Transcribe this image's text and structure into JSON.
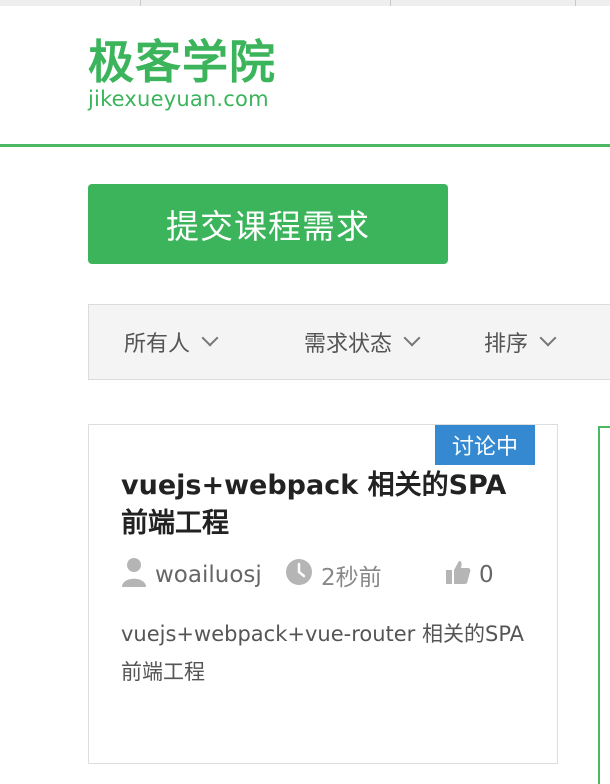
{
  "header": {
    "logo_cn": "极客学院",
    "logo_en": "jikexueyuan.com"
  },
  "actions": {
    "submit_label": "提交课程需求"
  },
  "filters": [
    {
      "label": "所有人"
    },
    {
      "label": "需求状态"
    },
    {
      "label": "排序"
    }
  ],
  "card": {
    "status": "讨论中",
    "title": "vuejs+webpack 相关的SPA前端工程",
    "author": "woailuosj",
    "time": "2秒前",
    "likes": "0",
    "description": "vuejs+webpack+vue-router 相关的SPA前端工程"
  },
  "colors": {
    "brand_green": "#3bb45c",
    "status_blue": "#3589d1"
  },
  "icons": {
    "author": "user-icon",
    "time": "clock-icon",
    "likes": "thumbs-up-icon",
    "dropdown": "chevron-down-icon"
  }
}
